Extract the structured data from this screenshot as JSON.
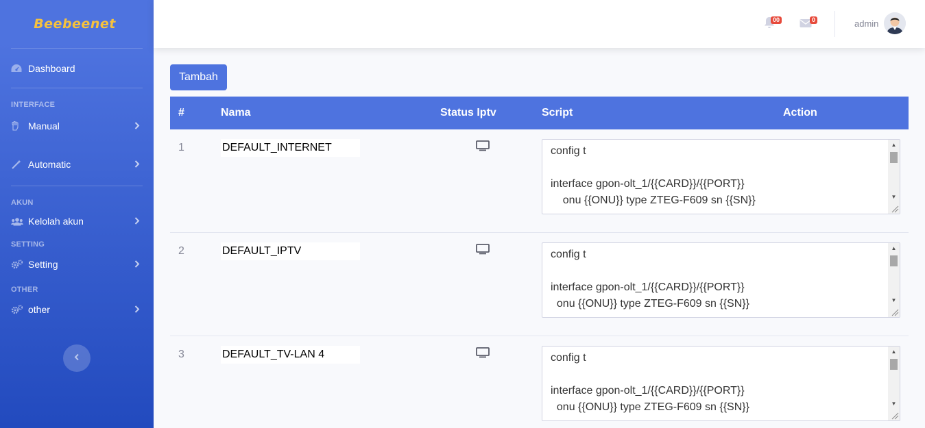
{
  "brand": {
    "name": "Beebeenet"
  },
  "sidebar": {
    "dashboard": {
      "label": "Dashboard",
      "icon": "tachometer-icon"
    },
    "headings": {
      "interface": "INTERFACE",
      "akun": "AKUN",
      "setting": "SETTING",
      "other": "OTHER"
    },
    "items": {
      "manual": {
        "label": "Manual",
        "icon": "hand-icon"
      },
      "automatic": {
        "label": "Automatic",
        "icon": "magic-wand-icon"
      },
      "kelolah_akun": {
        "label": "Kelolah akun",
        "icon": "users-icon"
      },
      "setting": {
        "label": "Setting",
        "icon": "cogs-icon"
      },
      "other": {
        "label": "other",
        "icon": "cogs-icon"
      }
    }
  },
  "topbar": {
    "alerts_count": "00",
    "messages_count": "0",
    "user_name": "admin"
  },
  "actions": {
    "add_label": "Tambah"
  },
  "table": {
    "headers": {
      "num": "#",
      "nama": "Nama",
      "status_iptv": "Status Iptv",
      "script": "Script",
      "action": "Action"
    },
    "rows": [
      {
        "num": "1",
        "nama": "DEFAULT_INTERNET",
        "script": "config t\n\ninterface gpon-olt_1/{{CARD}}/{{PORT}}\n    onu {{ONU}} type ZTEG-F609 sn {{SN}}"
      },
      {
        "num": "2",
        "nama": "DEFAULT_IPTV",
        "script": "config t\n\ninterface gpon-olt_1/{{CARD}}/{{PORT}}\n  onu {{ONU}} type ZTEG-F609 sn {{SN}}"
      },
      {
        "num": "3",
        "nama": "DEFAULT_TV-LAN 4",
        "script": "config t\n\ninterface gpon-olt_1/{{CARD}}/{{PORT}}\n  onu {{ONU}} type ZTEG-F609 sn {{SN}}"
      }
    ]
  },
  "colors": {
    "primary": "#4e73df",
    "brand": "#f6c23e",
    "badge": "#e74a3b"
  }
}
